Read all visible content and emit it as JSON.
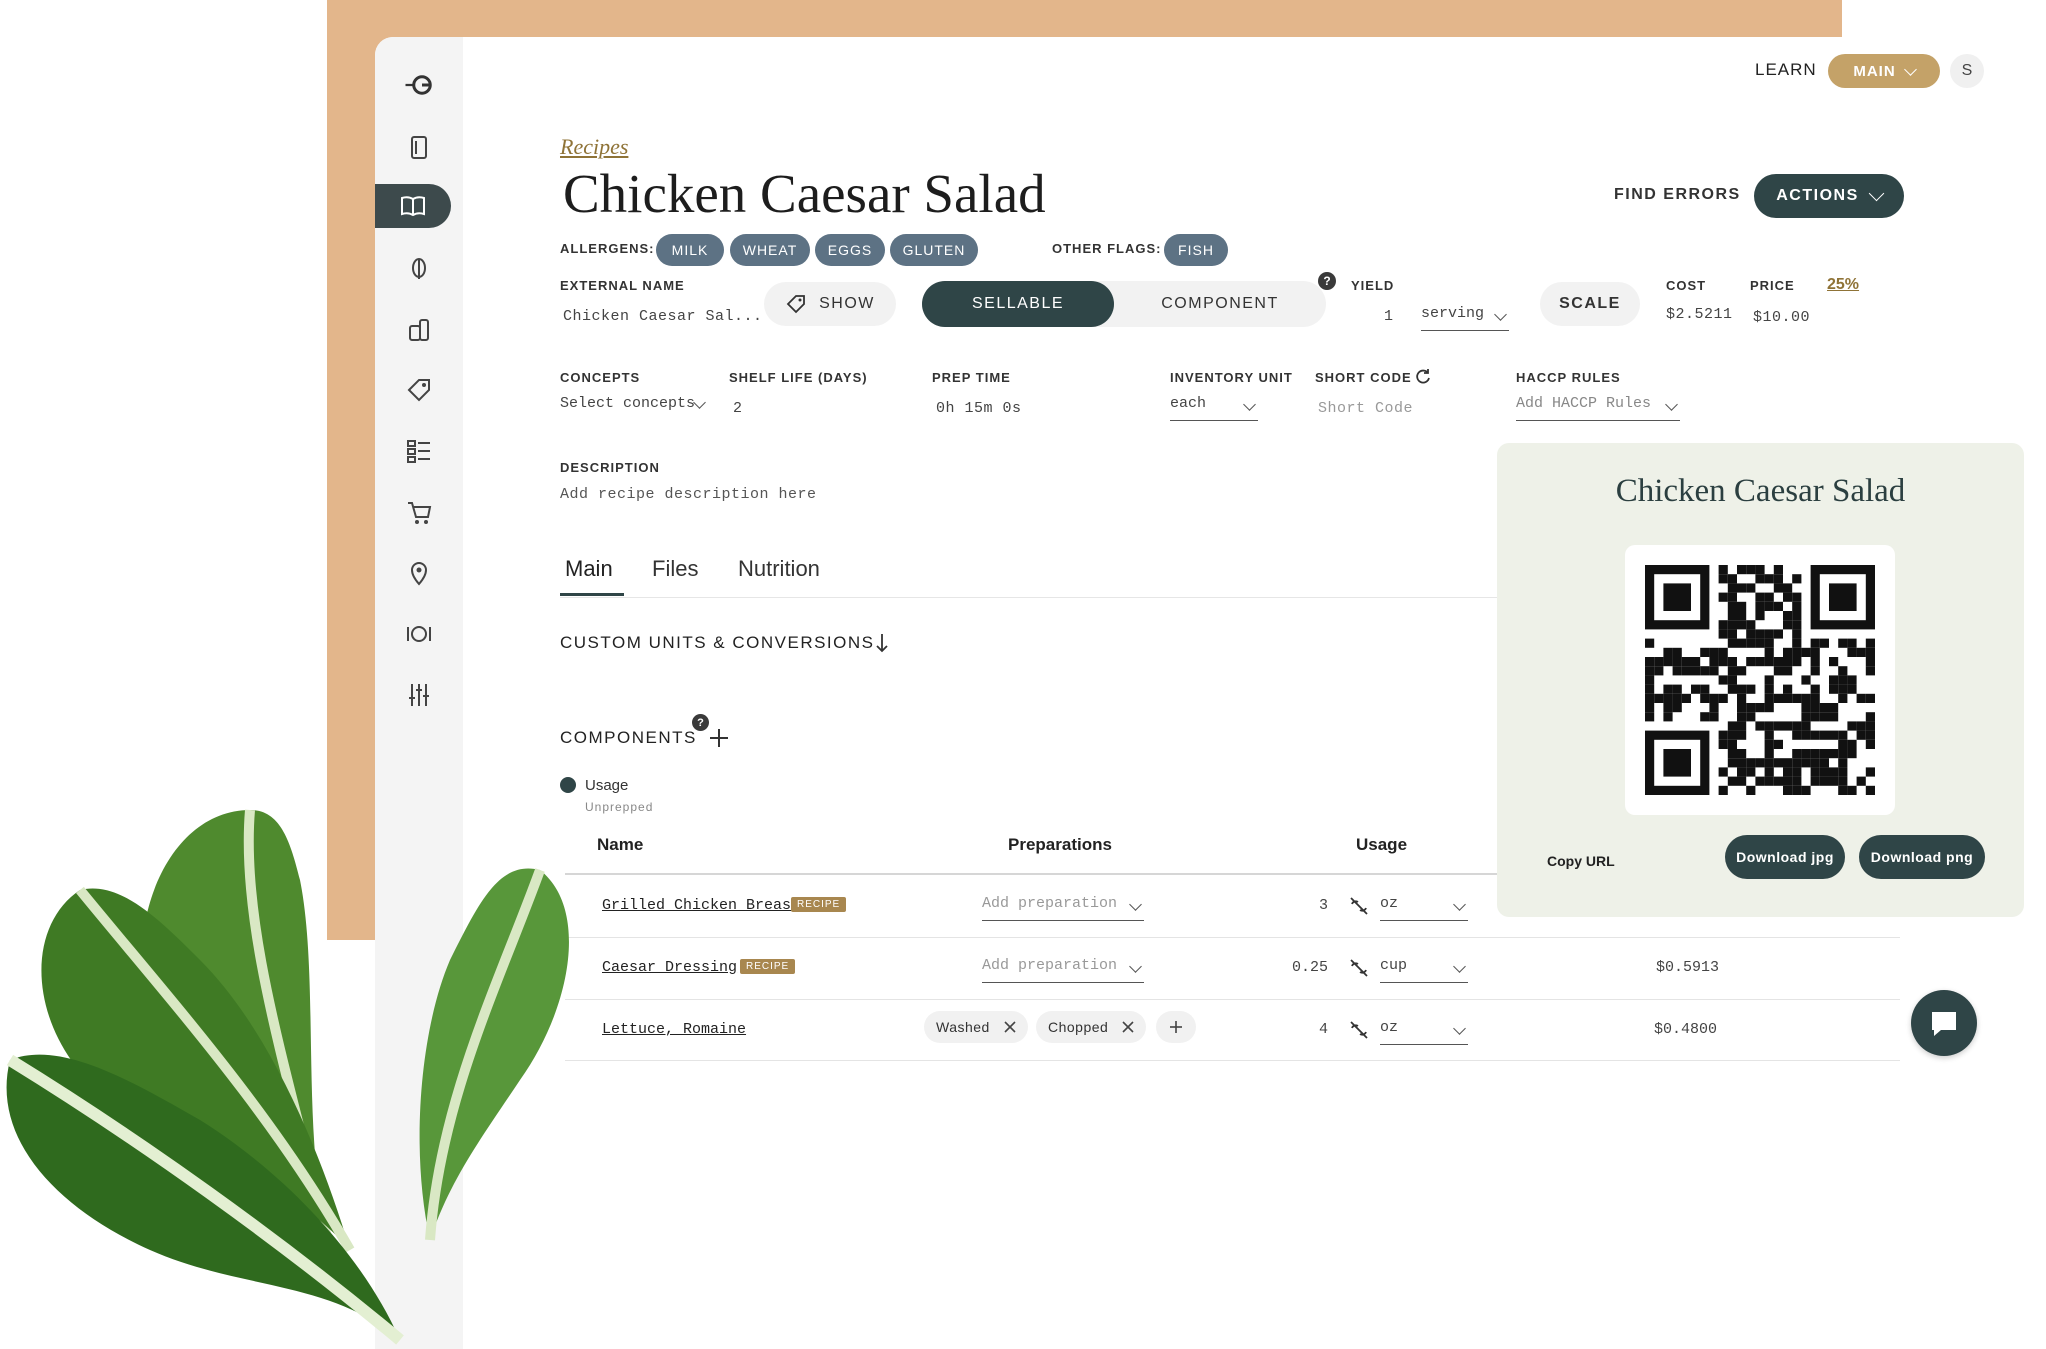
{
  "header": {
    "learn": "LEARN",
    "main_menu": "MAIN",
    "user_initial": "S"
  },
  "breadcrumb": "Recipes",
  "title": "Chicken Caesar Salad",
  "find_errors": "FIND ERRORS",
  "actions": "ACTIONS",
  "allergens": {
    "label": "ALLERGENS:",
    "items": [
      "MILK",
      "WHEAT",
      "EGGS",
      "GLUTEN"
    ]
  },
  "other_flags": {
    "label": "OTHER FLAGS:",
    "items": [
      "FISH"
    ]
  },
  "external_name": {
    "label": "EXTERNAL NAME",
    "value": "Chicken Caesar Sal..."
  },
  "show_button": "SHOW",
  "toggle": {
    "sellable": "SELLABLE",
    "component": "COMPONENT"
  },
  "help_mark": "?",
  "yield": {
    "label": "YIELD",
    "qty": "1",
    "unit": "serving"
  },
  "scale": "SCALE",
  "cost": {
    "label": "COST",
    "value": "$2.5211"
  },
  "price": {
    "label": "PRICE",
    "value": "$10.00",
    "percent": "25%"
  },
  "concepts": {
    "label": "CONCEPTS",
    "value": "Select concepts"
  },
  "shelf_life": {
    "label": "SHELF LIFE (DAYS)",
    "value": "2"
  },
  "prep_time": {
    "label": "PREP TIME",
    "value": "0h 15m 0s"
  },
  "inventory_unit": {
    "label": "INVENTORY UNIT",
    "value": "each"
  },
  "short_code": {
    "label": "SHORT CODE",
    "placeholder": "Short Code"
  },
  "haccp": {
    "label": "HACCP RULES",
    "value": "Add HACCP Rules"
  },
  "description": {
    "label": "DESCRIPTION",
    "placeholder": "Add recipe description here"
  },
  "tabs": [
    "Main",
    "Files",
    "Nutrition"
  ],
  "custom_units": "CUSTOM UNITS & CONVERSIONS",
  "components": {
    "label": "COMPONENTS"
  },
  "usage_toggle": {
    "on": "Usage",
    "off": "Unprepped"
  },
  "table": {
    "headers": {
      "name": "Name",
      "preparations": "Preparations",
      "usage": "Usage"
    },
    "rows": [
      {
        "name": "Grilled Chicken Breast",
        "badge": "RECIPE",
        "prep_placeholder": "Add preparation",
        "qty": "3",
        "unit": "oz",
        "cost": ""
      },
      {
        "name": "Caesar Dressing",
        "badge": "RECIPE",
        "prep_placeholder": "Add preparation",
        "qty": "0.25",
        "unit": "cup",
        "cost": "$0.5913"
      },
      {
        "name": "Lettuce, Romaine",
        "badge": "",
        "preps": [
          "Washed",
          "Chopped"
        ],
        "qty": "4",
        "unit": "oz",
        "cost": "$0.4800"
      }
    ]
  },
  "qr_panel": {
    "title": "Chicken Caesar Salad",
    "copy_url": "Copy URL",
    "download_jpg": "Download jpg",
    "download_png": "Download png"
  },
  "colors": {
    "accent_tan": "#e3b68b",
    "dark_teal": "#2f4547",
    "allergen_pill": "#5d7284",
    "gold_badge": "#a8874f"
  }
}
